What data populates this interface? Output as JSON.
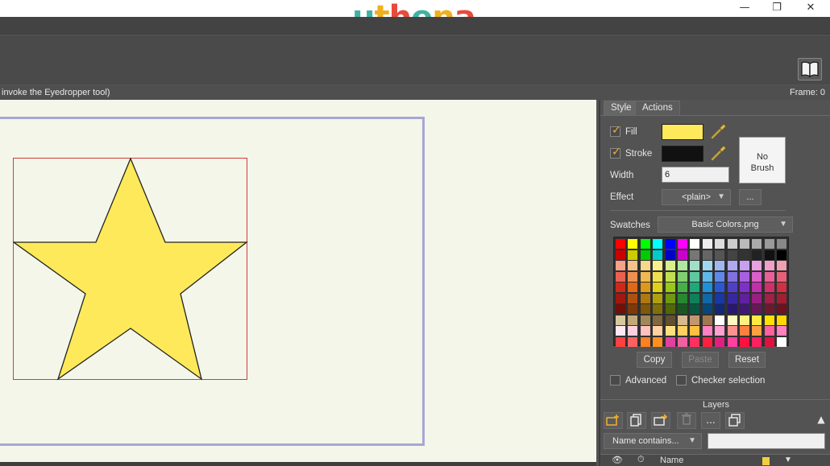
{
  "app": {
    "logo": "uthena",
    "logo_letters": [
      {
        "ch": "u",
        "color": "#40b2a4"
      },
      {
        "ch": "t",
        "color": "#f0b020"
      },
      {
        "ch": "h",
        "color": "#e84a3c"
      },
      {
        "ch": "e",
        "color": "#40b2a4"
      },
      {
        "ch": "n",
        "color": "#f0b020"
      },
      {
        "ch": "a",
        "color": "#e84a3c"
      }
    ]
  },
  "window": {
    "minimize": "—",
    "restore": "❐",
    "close": "✕"
  },
  "status": {
    "hint": "invoke the Eyedropper tool)",
    "frame": "Frame: 0"
  },
  "panel": {
    "tabs": [
      "Style",
      "Actions"
    ],
    "fill_label": "Fill",
    "fill_color": "#fde95a",
    "stroke_label": "Stroke",
    "stroke_color": "#111111",
    "width_label": "Width",
    "width_value": "6",
    "effect_label": "Effect",
    "effect_value": "<plain>",
    "effect_more": "...",
    "no_brush": [
      "No",
      "Brush"
    ],
    "swatches_label": "Swatches",
    "swatches_file": "Basic Colors.png",
    "copy": "Copy",
    "paste": "Paste",
    "reset": "Reset",
    "advanced": "Advanced",
    "checker": "Checker selection"
  },
  "layers": {
    "title": "Layers",
    "filter_value": "Name contains...",
    "col_name": "Name",
    "tool_more": "..."
  },
  "palette": [
    [
      "#ff0000",
      "#ffff00",
      "#00ff00",
      "#00ffff",
      "#0000ff",
      "#ff00ff",
      "#ffffff",
      "#eeeeee",
      "#dddddd",
      "#cccccc",
      "#bbbbbb",
      "#aaaaaa",
      "#999999",
      "#888888"
    ],
    [
      "#cc0000",
      "#cccc00",
      "#00cc00",
      "#00cccc",
      "#0000cc",
      "#cc00cc",
      "#777777",
      "#666666",
      "#555555",
      "#444444",
      "#333333",
      "#222222",
      "#111111",
      "#000000"
    ],
    [
      "#f7a08a",
      "#f8c08a",
      "#f8d88a",
      "#f8f08a",
      "#d8f08a",
      "#b0e8a0",
      "#a0e0c8",
      "#a0d8f0",
      "#a0b8f0",
      "#b0a8f0",
      "#c8a0f0",
      "#e8a0e0",
      "#f0a0c8",
      "#f0a0b0"
    ],
    [
      "#e86050",
      "#f09050",
      "#f0b850",
      "#f0e050",
      "#c0e050",
      "#80d070",
      "#60c8a0",
      "#60b8e8",
      "#6088e8",
      "#8070e0",
      "#a860e0",
      "#d860c8",
      "#e86098",
      "#e86078"
    ],
    [
      "#d02818",
      "#e06818",
      "#e09818",
      "#e0d018",
      "#98c818",
      "#48b048",
      "#20a878",
      "#2090d8",
      "#2858d8",
      "#5040c8",
      "#8030c8",
      "#c030a8",
      "#d03068",
      "#d03040"
    ],
    [
      "#a01810",
      "#b05010",
      "#b07810",
      "#b0a010",
      "#709810",
      "#288830",
      "#108058",
      "#1068a8",
      "#1838a8",
      "#3828a0",
      "#6020a0",
      "#982080",
      "#a02048",
      "#a02030"
    ],
    [
      "#701008",
      "#803808",
      "#805808",
      "#807008",
      "#506808",
      "#185820",
      "#085840",
      "#084878",
      "#102878",
      "#281870",
      "#401870",
      "#681858",
      "#701830",
      "#701020"
    ],
    [
      "#d8c8a0",
      "#c0a878",
      "#a08858",
      "#806840",
      "#605030",
      "#d8b890",
      "#c09870",
      "#a07850",
      "#ffffff",
      "#fff8c0",
      "#fff080",
      "#ffe840",
      "#ffe000",
      "#ffd800"
    ],
    [
      "#ffe8f0",
      "#ffd0e0",
      "#ffc0c0",
      "#ffd0a0",
      "#ffe080",
      "#ffd060",
      "#ffc040",
      "#ff80c0",
      "#ffa0d0",
      "#ff9090",
      "#ff8040",
      "#ffa040",
      "#ff60a0",
      "#ff80c0"
    ],
    [
      "#ff4040",
      "#ff6060",
      "#ff8020",
      "#ff9020",
      "#e040a0",
      "#f060a0",
      "#ff3060",
      "#ff2040",
      "#e02080",
      "#ff40a0",
      "#ff1040",
      "#ff2060",
      "#e01040",
      "#ffffff"
    ]
  ]
}
